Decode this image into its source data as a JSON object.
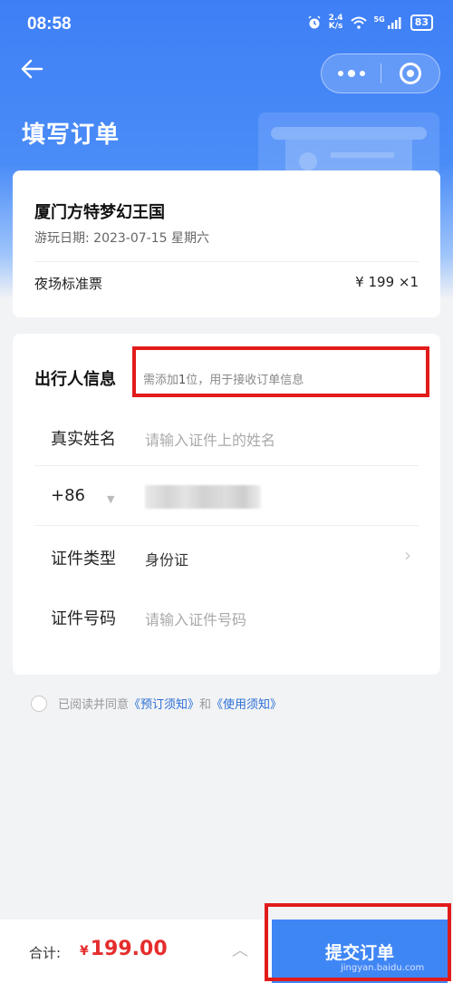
{
  "status_bar": {
    "time": "08:58",
    "net_speed_top": "2.4",
    "net_speed_bottom": "K/s",
    "signal_label": "5G",
    "battery": "83"
  },
  "header": {
    "title": "填写订单",
    "back_icon": "arrow-left-icon",
    "more_icon": "more-dots-icon",
    "close_icon": "target-close-icon"
  },
  "order": {
    "park_name": "厦门方特梦幻王国",
    "visit_date": "游玩日期: 2023-07-15 星期六",
    "ticket_name": "夜场标准票",
    "ticket_price": "¥ 199 ×1"
  },
  "traveler": {
    "title": "出行人信息",
    "hint_prefix": "需添加",
    "hint_count": "1",
    "hint_suffix": "位，用于接收订单信息",
    "fields": [
      {
        "label": "真实姓名",
        "placeholder": "请输入证件上的姓名"
      },
      {
        "label": "+86",
        "value": ""
      },
      {
        "label": "证件类型",
        "value": "身份证"
      },
      {
        "label": "证件号码",
        "placeholder": "请输入证件号码"
      }
    ]
  },
  "agreement": {
    "prefix": "已阅读并同意",
    "link1": "《预订须知》",
    "and": "和",
    "link2": "《使用须知》"
  },
  "footer": {
    "total_label": "合计:",
    "currency": "¥",
    "total_amount": "199.00",
    "submit_label": "提交订单"
  },
  "watermark": "jingyan.baidu.com",
  "colors": {
    "header_blue": "#3f7ff6",
    "submit_blue": "#3f86f5",
    "price_red": "#e52d2d",
    "highlight_red": "#e11b1b",
    "link_blue": "#2b6fd6"
  }
}
